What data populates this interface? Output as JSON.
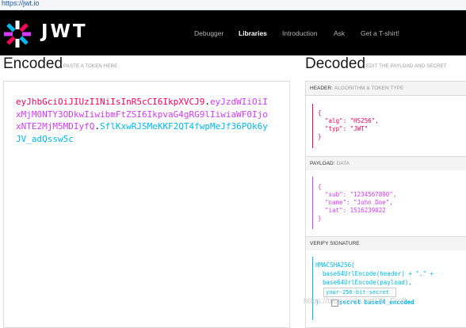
{
  "browser": {
    "url": "https://jwt.io"
  },
  "logo": {
    "text": "JWT"
  },
  "nav": [
    {
      "label": "Debugger",
      "active": false
    },
    {
      "label": "Libraries",
      "active": true
    },
    {
      "label": "Introduction",
      "active": false
    },
    {
      "label": "Ask",
      "active": false
    },
    {
      "label": "Get a T-shirt!",
      "active": false
    }
  ],
  "encoded": {
    "title": "Encoded",
    "subtitle": "PASTE A TOKEN HERE",
    "token_header": "eyJhbGciOiJIUzI1NiIsInR5cCI6IkpXVCJ9",
    "token_payload": "eyJzdWIiOiIxMjM0NTY3ODkwIiwibmFtZSI6IkpvaG4gRG9lIiwiaWF0IjoxNTE2MjM5MDIyfQ",
    "token_signature": "SflKxwRJSMeKKF2QT4fwpMeJf36POk6yJV_adQssw5c",
    "dot": "."
  },
  "decoded": {
    "title": "Decoded",
    "subtitle": "EDIT THE PAYLOAD AND SECRET",
    "header_label": "HEADER:",
    "header_sub": "ALGORITHM & TOKEN TYPE",
    "header_code": [
      "{",
      "  \"alg\": \"HS256\",",
      "  \"typ\": \"JWT\"",
      "}"
    ],
    "payload_label": "PAYLOAD:",
    "payload_sub": "DATA",
    "payload_code": [
      "{",
      "  \"sub\": \"1234567890\",",
      "  \"name\": \"John Doe\",",
      "  \"iat\": 1516239022",
      "}"
    ],
    "verify_label": "VERIFY SIGNATURE",
    "verify_code": [
      "HMACSHA256(",
      "  base64UrlEncode(header) + \".\" +",
      "  base64UrlEncode(payload),"
    ],
    "secret_value": "your-256-bit-secret",
    "close_paren": ")",
    "secret_base64_label": "secret base64 encoded"
  },
  "watermark": "https://blog.csdn.net/JK_Frolf",
  "colors": {
    "header": "#fb015b",
    "payload": "#d63aff",
    "signature": "#00b9f1"
  }
}
